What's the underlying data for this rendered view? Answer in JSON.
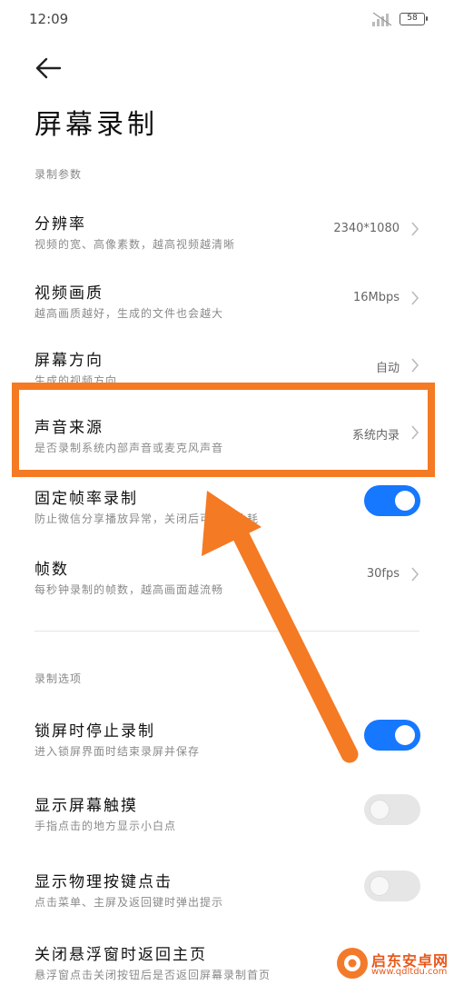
{
  "status_bar": {
    "time": "12:09",
    "battery": "58"
  },
  "page": {
    "title": "屏幕录制"
  },
  "sections": {
    "params_label": "录制参数",
    "options_label": "录制选项"
  },
  "params": [
    {
      "title": "分辨率",
      "subtitle": "视频的宽、高像素数，越高视频越清晰",
      "value": "2340*1080"
    },
    {
      "title": "视频画质",
      "subtitle": "越高画质越好，生成的文件也会越大",
      "value": "16Mbps"
    },
    {
      "title": "屏幕方向",
      "subtitle": "生成的视频方向",
      "value": "自动"
    },
    {
      "title": "声音来源",
      "subtitle": "是否录制系统内部声音或麦克风声音",
      "value": "系统内录"
    },
    {
      "title": "固定帧率录制",
      "subtitle": "防止微信分享播放异常，关闭后可降低功耗",
      "toggle": true
    },
    {
      "title": "帧数",
      "subtitle": "每秒钟录制的帧数，越高画面越流畅",
      "value": "30fps"
    }
  ],
  "options": [
    {
      "title": "锁屏时停止录制",
      "subtitle": "进入锁屏界面时结束录屏并保存",
      "toggle": true
    },
    {
      "title": "显示屏幕触摸",
      "subtitle": "手指点击的地方显示小白点",
      "toggle": false
    },
    {
      "title": "显示物理按键点击",
      "subtitle": "点击菜单、主屏及返回键时弹出提示",
      "toggle": false
    },
    {
      "title": "关闭悬浮窗时返回主页",
      "subtitle": "悬浮窗点击关闭按钮后是否返回屏幕录制首页"
    }
  ],
  "watermark": {
    "text": "启东安卓网",
    "url": "www.qdltdu.com"
  },
  "colors": {
    "accent": "#1677ff",
    "highlight": "#f47a23"
  },
  "icons": {
    "back": "arrow-left-icon",
    "chevron": "chevron-right-icon"
  }
}
